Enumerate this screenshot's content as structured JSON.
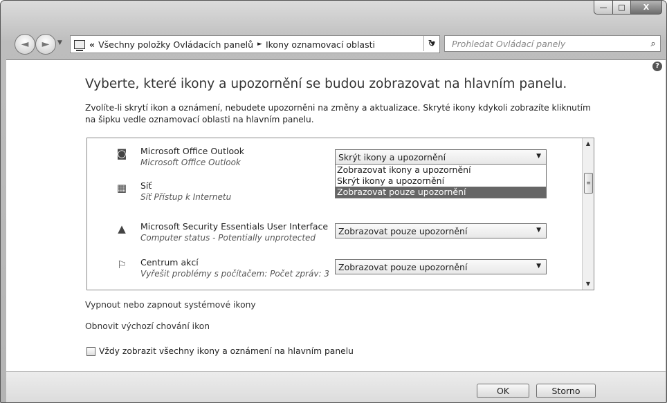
{
  "window": {
    "minimize_glyph": "—",
    "maximize_glyph": "□",
    "close_glyph": "X"
  },
  "navigation": {
    "back_glyph": "◄",
    "forward_glyph": "►",
    "address": {
      "prefix": "«",
      "crumbs": [
        "Všechny položky Ovládacích panelů",
        "Ikony oznamovací oblasti"
      ],
      "separator": "►"
    },
    "refresh_glyph": "↻",
    "search_placeholder": "Prohledat Ovládací panely"
  },
  "main": {
    "help_glyph": "?",
    "title": "Vyberte, které ikony a upozornění se budou zobrazovat na hlavním panelu.",
    "description": "Zvolíte-li skrytí ikon a oznámení, nebudete upozorněni na změny a aktualizace. Skryté ikony kdykoli zobrazíte kliknutím na šipku vedle oznamovací oblasti na hlavním panelu.",
    "items": [
      {
        "icon": "outlook-icon",
        "glyph": "◙",
        "name": "Microsoft Office Outlook",
        "sub": "Microsoft Office Outlook",
        "behavior": "Skrýt ikony a upozornění"
      },
      {
        "icon": "network-icon",
        "glyph": "▦",
        "name": "Síť",
        "sub": "Síť Přístup k Internetu",
        "behavior": ""
      },
      {
        "icon": "security-essentials-icon",
        "glyph": "▲",
        "name": "Microsoft Security Essentials User Interface",
        "sub": "Computer status - Potentially unprotected",
        "behavior": "Zobrazovat pouze upozornění"
      },
      {
        "icon": "action-center-flag-icon",
        "glyph": "⚐",
        "name": "Centrum akcí",
        "sub": "Vyřešit problémy s počítačem: Počet zpráv: 3",
        "behavior": "Zobrazovat pouze upozornění"
      }
    ],
    "dropdown_options": [
      "Zobrazovat ikony a upozornění",
      "Skrýt ikony a upozornění",
      "Zobrazovat pouze upozornění"
    ],
    "dropdown_highlighted": "Zobrazovat pouze upozornění",
    "links": {
      "system_icons": "Vypnout nebo zapnout systémové ikony",
      "restore_defaults": "Obnovit výchozí chování ikon"
    },
    "always_show_checkbox": {
      "label": "Vždy zobrazit všechny ikony a oznámení na hlavním panelu",
      "checked": false
    }
  },
  "footer": {
    "ok": "OK",
    "cancel": "Storno"
  }
}
